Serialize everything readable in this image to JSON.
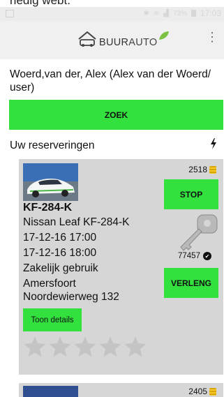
{
  "top_crop_text": "rledig webt.",
  "statusbar": {
    "battery_pct": "73%",
    "time": "17:03"
  },
  "app": {
    "logo_part1": "BUUR",
    "logo_part2": "AUTO"
  },
  "user": {
    "name": "Woerd,van der, Alex (Alex van der Woerd/ user)"
  },
  "search": {
    "button_label": "ZOEK"
  },
  "reservations": {
    "header": "Uw reserveringen",
    "items": [
      {
        "plate": "KF-284-K",
        "model": "Nissan Leaf KF-284-K",
        "start": "17-12-16 17:00",
        "end": "17-12-16 18:00",
        "usage": "Zakelijk gebruik",
        "city": "Amersfoort",
        "address": "Noordewierweg 132",
        "credits": "2518",
        "key_number": "77457",
        "stop_label": "STOP",
        "extend_label": "VERLENG",
        "details_label": "Toon details",
        "rating_stars": 0,
        "rating_max": 5
      },
      {
        "credits": "2405"
      }
    ]
  },
  "colors": {
    "accent_green": "#33e13e",
    "card_bg": "#d6d6d6",
    "appbar_bg": "#f0f0f0",
    "leaf_green": "#7cc242"
  }
}
